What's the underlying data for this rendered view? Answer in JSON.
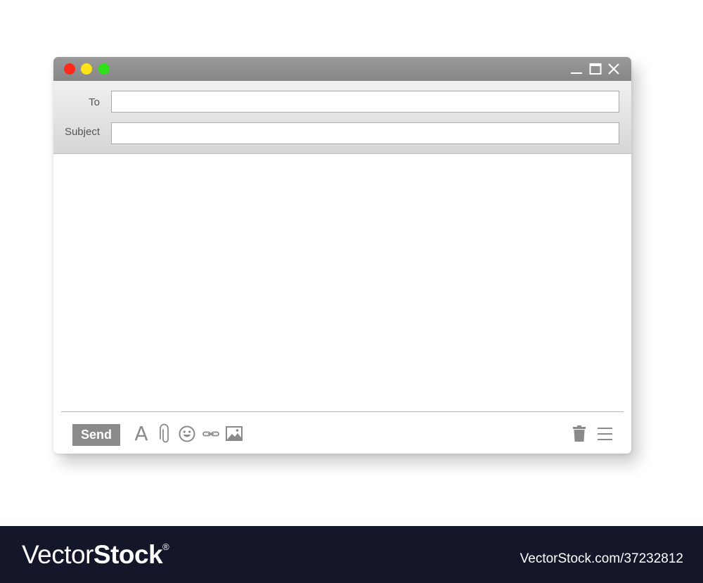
{
  "window": {
    "controls": {
      "close_dot_color": "#ff2a1a",
      "minimize_dot_color": "#ffe21a",
      "zoom_dot_color": "#2fe01a"
    },
    "titlebar_icons": [
      "minimize-icon",
      "maximize-icon",
      "close-icon"
    ]
  },
  "compose": {
    "to_label": "To",
    "to_value": "",
    "subject_label": "Subject",
    "subject_value": "",
    "body_value": ""
  },
  "toolbar": {
    "send_label": "Send",
    "font_glyph": "A",
    "icons": [
      "font-icon",
      "paperclip-icon",
      "emoji-icon",
      "link-icon",
      "image-icon",
      "trash-icon",
      "menu-icon"
    ]
  },
  "watermark": {
    "brand_light": "Vector",
    "brand_bold": "Stock",
    "brand_mark": "®",
    "credit": "VectorStock.com/37232812"
  },
  "colors": {
    "titlebar": "#8c8c8c",
    "send_button": "#8a8a8a",
    "icon_gray": "#8a8a8a",
    "footer": "#141629"
  }
}
